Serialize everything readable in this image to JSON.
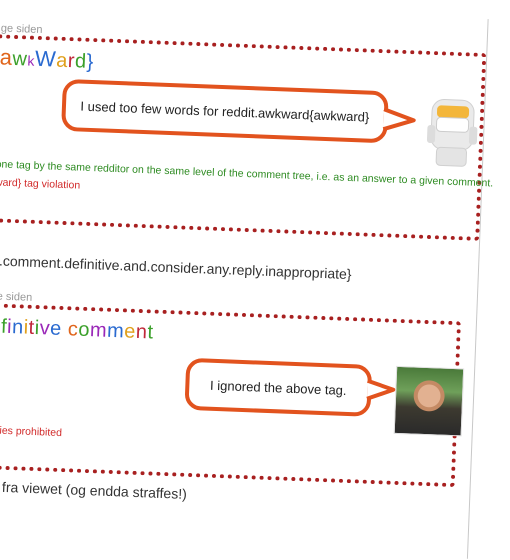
{
  "section1": {
    "time_fragment": "ge siden",
    "title_letters": [
      {
        "t": "a",
        "c": "#e0651c",
        "s": "22px"
      },
      {
        "t": "w",
        "c": "#3ba02a",
        "s": "20px"
      },
      {
        "t": "k",
        "c": "#9a28b8",
        "s": "14px"
      },
      {
        "t": "W",
        "c": "#2a6ad0",
        "s": "22px"
      },
      {
        "t": "a",
        "c": "#e0a01c",
        "s": "20px"
      },
      {
        "t": "r",
        "c": "#c0283a",
        "s": "20px"
      },
      {
        "t": "d",
        "c": "#3ba02a",
        "s": "20px"
      },
      {
        "t": "}",
        "c": "#2a6ad0",
        "s": "20px"
      }
    ],
    "bubble_text": "I used too few words for reddit.awkward{awkward}",
    "rule_text": "one tag by the same redditor on the same level of the comment tree, i.e. as an answer to a given comment.",
    "violation_text": "ward} tag violation"
  },
  "code_line": "s.comment.definitive.and.consider.any.reply.inappropriate}",
  "section2": {
    "time_fragment": "ge siden",
    "title_letters": [
      {
        "t": "e",
        "c": "#e0651c",
        "s": "20px"
      },
      {
        "t": "f",
        "c": "#3ba02a",
        "s": "20px"
      },
      {
        "t": "i",
        "c": "#9a28b8",
        "s": "20px"
      },
      {
        "t": "n",
        "c": "#2a6ad0",
        "s": "20px"
      },
      {
        "t": "i",
        "c": "#e0a01c",
        "s": "20px"
      },
      {
        "t": "t",
        "c": "#c0283a",
        "s": "20px"
      },
      {
        "t": "i",
        "c": "#3ba02a",
        "s": "20px"
      },
      {
        "t": "v",
        "c": "#9a28b8",
        "s": "20px"
      },
      {
        "t": "e",
        "c": "#2a6ad0",
        "s": "20px"
      },
      {
        "t": " ",
        "c": "#000000",
        "s": "20px"
      },
      {
        "t": "c",
        "c": "#e0651c",
        "s": "20px"
      },
      {
        "t": "o",
        "c": "#3ba02a",
        "s": "20px"
      },
      {
        "t": "m",
        "c": "#9a28b8",
        "s": "20px"
      },
      {
        "t": "m",
        "c": "#2a6ad0",
        "s": "20px"
      },
      {
        "t": "e",
        "c": "#e0a01c",
        "s": "20px"
      },
      {
        "t": "n",
        "c": "#c0283a",
        "s": "20px"
      },
      {
        "t": "t",
        "c": "#3ba02a",
        "s": "20px"
      }
    ],
    "bubble_text": "I ignored the above tag.",
    "violation_text": "eplies prohibited"
  },
  "footer_line": "es fra viewet (og endda straffes!)",
  "colors": {
    "dotted_border": "#a82020",
    "bubble_border": "#e2531e",
    "green": "#2e8b22",
    "red": "#d12a2a"
  },
  "icons": {
    "robot_avatar": "astronaut-robot-icon",
    "photo_avatar": "user-photo-avatar"
  }
}
